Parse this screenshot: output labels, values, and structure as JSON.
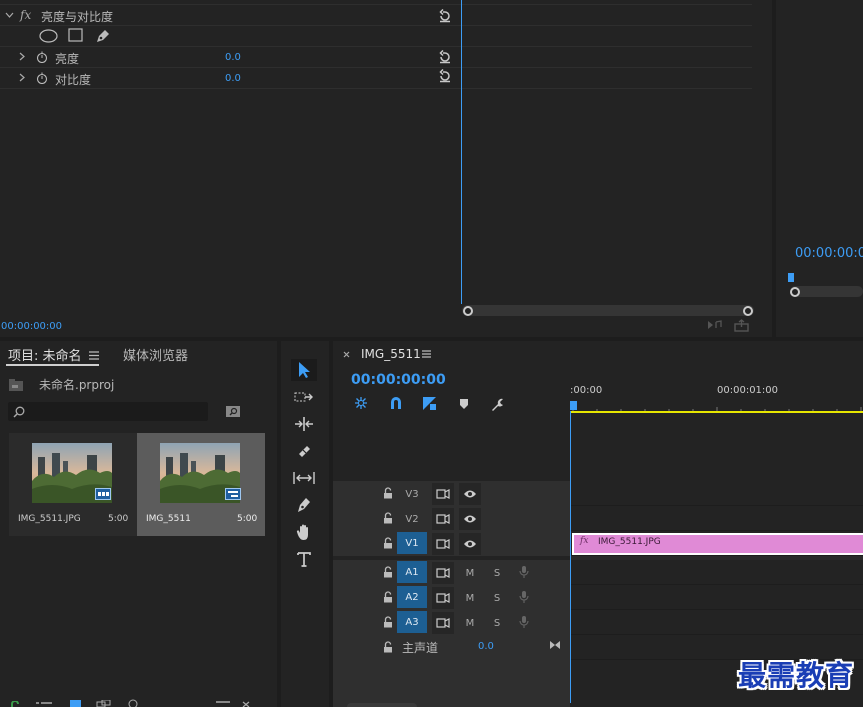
{
  "effect_controls": {
    "effect_name": "亮度与对比度",
    "fx_label": "fx",
    "params": [
      {
        "name": "亮度",
        "value": "0.0"
      },
      {
        "name": "对比度",
        "value": "0.0"
      }
    ],
    "timecode": "00:00:00:00"
  },
  "program_monitor": {
    "timecode": "00:00:00:0"
  },
  "project": {
    "tabs": [
      {
        "label": "项目: 未命名"
      },
      {
        "label": "媒体浏览器"
      }
    ],
    "file_name": "未命名.prproj",
    "search": {
      "placeholder": ""
    },
    "items": [
      {
        "name": "IMG_5511.JPG",
        "duration": "5:00",
        "selected": false
      },
      {
        "name": "IMG_5511",
        "duration": "5:00",
        "selected": true
      }
    ]
  },
  "timeline": {
    "tab": "IMG_5511",
    "timecode": "00:00:00:00",
    "ruler": [
      ":00:00",
      "00:00:01:00"
    ],
    "video_tracks": [
      {
        "name": "V3",
        "target": false
      },
      {
        "name": "V2",
        "target": false
      },
      {
        "name": "V1",
        "target": true
      }
    ],
    "audio_tracks": [
      {
        "name": "A1",
        "m": "M",
        "s": "S"
      },
      {
        "name": "A2",
        "m": "M",
        "s": "S"
      },
      {
        "name": "A3",
        "m": "M",
        "s": "S"
      }
    ],
    "master": {
      "name": "主声道",
      "value": "0.0"
    },
    "clip": {
      "fx": "fx",
      "name": "IMG_5511.JPG"
    }
  },
  "colors": {
    "accent": "#3d9df5",
    "clip": "#e08ad6",
    "work_area": "#e6e600"
  },
  "watermark": "最需教育"
}
